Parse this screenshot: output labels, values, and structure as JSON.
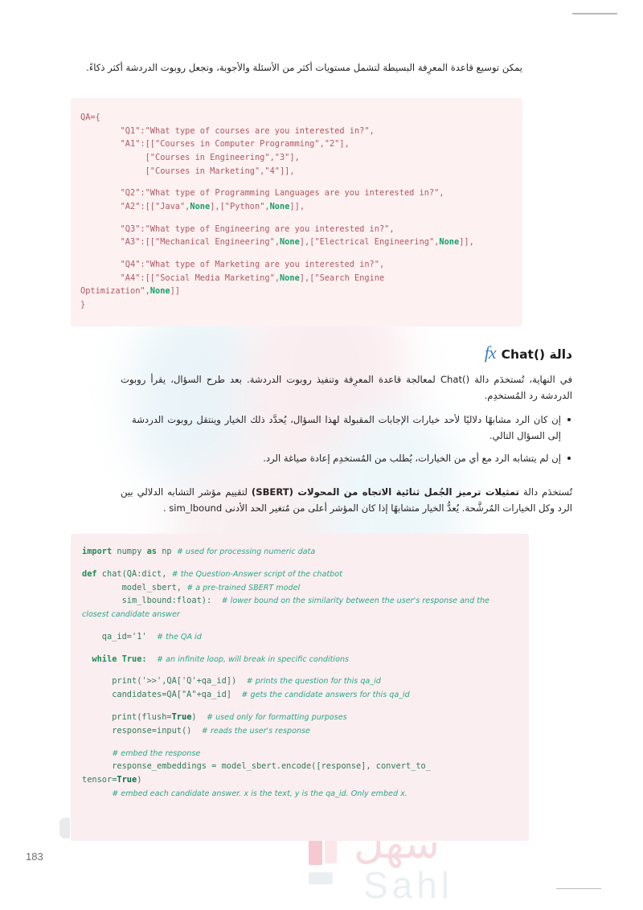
{
  "document": {
    "page_number": "183",
    "watermark": {
      "arabic": "سهل",
      "latin": "Sahl"
    }
  },
  "intro_paragraph": "يمكن توسيع قاعدة المعرِفة البسيطة لتشمل مستويات أكثر من الأسئلة والأجوبة، وتجعل روبوت الدردشة أكثر ذكاءً.",
  "code_block_qa": {
    "language": "python",
    "lines": [
      "QA={",
      "        \"Q1\":\"What type of courses are you interested in?\",",
      "        \"A1\":[[\"Courses in Computer Programming\",\"2\"],",
      "             [\"Courses in Engineering\",\"3\"],",
      "             [\"Courses in Marketing\",\"4\"]],",
      "",
      "        \"Q2\":\"What type of Programming Languages are you interested in?\",",
      "        \"A2\":[[\"Java\",None],[\"Python\",None]],",
      "",
      "        \"Q3\":\"What type of Engineering are you interested in?\",",
      "        \"A3\":[[\"Mechanical Engineering\",None],[\"Electrical Engineering\",None]],",
      "",
      "        \"Q4\":\"What type of Marketing are you interested in?\",",
      "        \"A4\":[[\"Social Media Marketing\",None],[\"Search Engine",
      "Optimization\",None]]",
      "}"
    ]
  },
  "section": {
    "icon": "fx-icon",
    "icon_label": "fx",
    "title": "دالة ()Chat"
  },
  "section_intro": "في النهاية، تُستخدَم دالة ()Chat لمعالجة قاعدة المعرِفة وتنفيذ روبوت الدردشة. بعد طرح السؤال، يقرأ روبوت الدردشة رد المُستخدِم.",
  "bullets": [
    "إن كان الرد مشابهًا دلاليًا لأحد خيارات الإجابات المقبولة لهذا السؤال، يُحدَّد ذلك الخيار وينتقل روبوت الدردشة إلى السؤال التالي.",
    "إن لم يتشابه الرد مع أي من الخيارات، يُطلب من المُستخدِم إعادة صياغة الرد."
  ],
  "sbert_paragraph": {
    "lead": "تُستخدَم دالة ",
    "bold": "تمثيلات ترميز الجُمل ثنائية الاتجاه من المحولات (SBERT)",
    "rest": " لتقييم مؤشر التشابه الدلالي بين الرد وكل الخيارات المُرشَّحة. يُعدُّ الخيار متشابهًا إذا كان المؤشر أعلى من مُتغير الحد الأدنى ",
    "variable": "sim_lbound",
    "tail": " ."
  },
  "code_block_chat": {
    "language": "python",
    "lines": [
      {
        "code": "import",
        "kind": "kw",
        "after": " numpy ",
        "kw2": "as",
        "after2": " np ",
        "comment": "# used for processing numeric data"
      },
      {
        "code": "def",
        "kind": "kw",
        "after": " chat(QA:dict, ",
        "comment": "# the Question-Answer script of the chatbot"
      },
      {
        "code": "        model_sbert, ",
        "comment": "# a pre-trained SBERT model"
      },
      {
        "code": "        sim_lbound:float):  ",
        "comment": "# lower bound on the similarity between the user's response and the"
      },
      {
        "comment": "closest candidate answer"
      },
      {
        "code": "    qa_id='1'  ",
        "comment": "# the QA id"
      },
      {
        "code": "  while True:  ",
        "kind": "kw",
        "comment": "# an infinite loop, will break in specific conditions"
      },
      {
        "code": "      print('>>',QA['Q'+qa_id])  ",
        "comment": "# prints the question for this qa_id"
      },
      {
        "code": "      candidates=QA[\"A\"+qa_id]  ",
        "comment": "# gets the candidate answers for this qa_id"
      },
      {
        "code": "      print(flush=True)  ",
        "comment": "# used only for formatting purposes"
      },
      {
        "code": "      response=input()  ",
        "comment": "# reads the user's response"
      },
      {
        "comment": "      # embed the response"
      },
      {
        "code": "      response_embeddings = model_sbert.encode([response], convert_to_"
      },
      {
        "code": "tensor=True)"
      },
      {
        "comment": "      # embed each candidate answer. x is the text, y is the qa_id. Only embed x."
      }
    ]
  }
}
